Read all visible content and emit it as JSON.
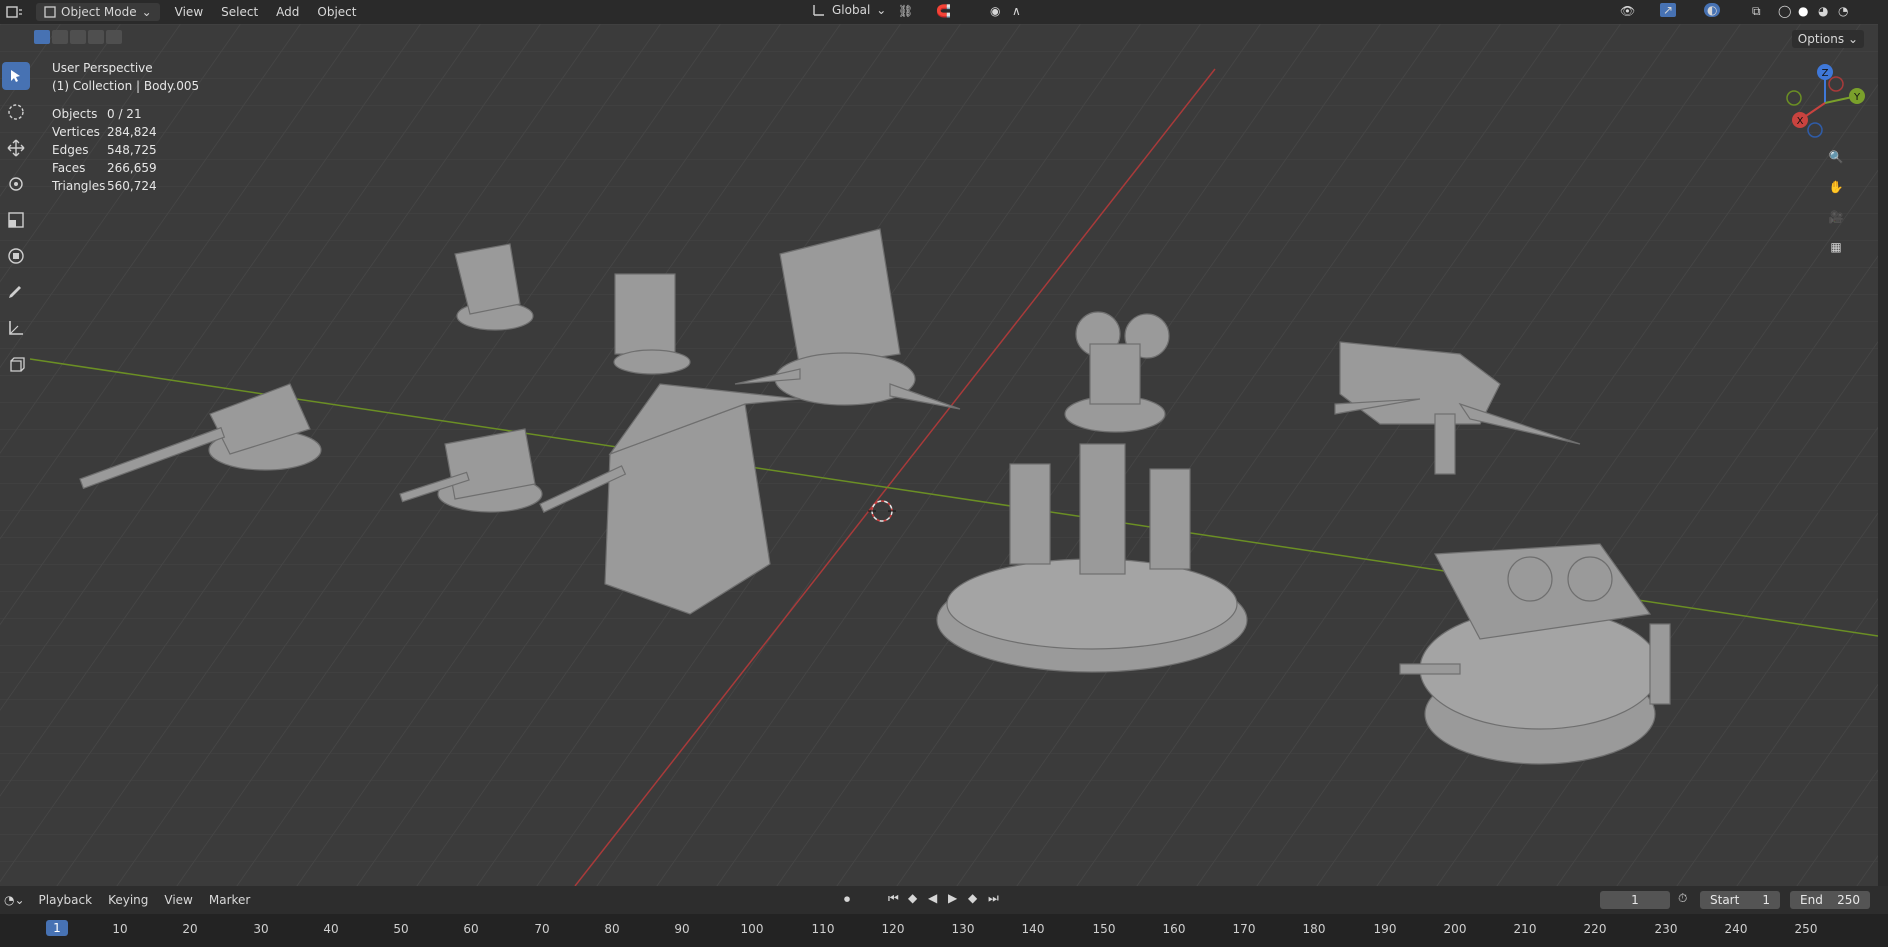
{
  "header": {
    "mode": "Object Mode",
    "menu": [
      "View",
      "Select",
      "Add",
      "Object"
    ],
    "transform_orientation": "Global",
    "options_label": "Options"
  },
  "viewport": {
    "perspective": "User Perspective",
    "collection": "(1) Collection | Body.005",
    "stats": [
      {
        "label": "Objects",
        "value": "0 / 21"
      },
      {
        "label": "Vertices",
        "value": "284,824"
      },
      {
        "label": "Edges",
        "value": "548,725"
      },
      {
        "label": "Faces",
        "value": "266,659"
      },
      {
        "label": "Triangles",
        "value": "560,724"
      }
    ],
    "gizmo": {
      "x": "X",
      "y": "Y",
      "z": "Z"
    }
  },
  "timeline": {
    "menu": [
      "Playback",
      "Keying",
      "View",
      "Marker"
    ],
    "current_frame": "1",
    "start_label": "Start",
    "start_value": "1",
    "end_label": "End",
    "end_value": "250",
    "ruler": [
      "10",
      "20",
      "30",
      "40",
      "50",
      "60",
      "70",
      "80",
      "90",
      "100",
      "110",
      "120",
      "130",
      "140",
      "150",
      "160",
      "170",
      "180",
      "190",
      "200",
      "210",
      "220",
      "230",
      "240",
      "250"
    ],
    "ruler_current": "1"
  },
  "colors": {
    "accent": "#4772b3",
    "x_axis": "#c9433f",
    "y_axis": "#7aa02b",
    "z_axis": "#3f78d9"
  }
}
